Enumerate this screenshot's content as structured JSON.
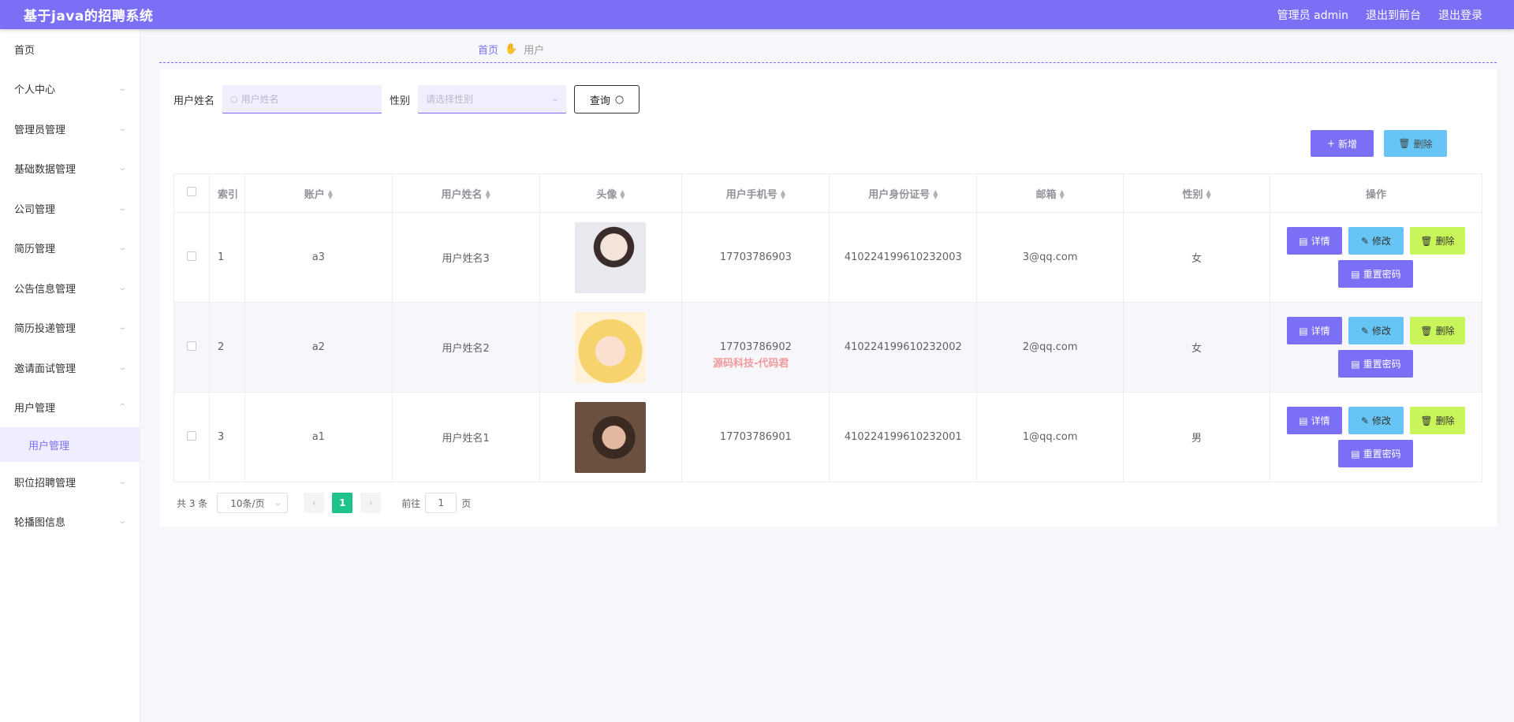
{
  "header": {
    "title": "基于java的招聘系统",
    "admin_label": "管理员 admin",
    "back_to_front": "退出到前台",
    "logout": "退出登录"
  },
  "sidebar": {
    "items": [
      {
        "label": "首页",
        "has_arrow": false
      },
      {
        "label": "个人中心",
        "has_arrow": true
      },
      {
        "label": "管理员管理",
        "has_arrow": true
      },
      {
        "label": "基础数据管理",
        "has_arrow": true
      },
      {
        "label": "公司管理",
        "has_arrow": true
      },
      {
        "label": "简历管理",
        "has_arrow": true
      },
      {
        "label": "公告信息管理",
        "has_arrow": true
      },
      {
        "label": "简历投递管理",
        "has_arrow": true
      },
      {
        "label": "邀请面试管理",
        "has_arrow": true
      },
      {
        "label": "用户管理",
        "has_arrow": true,
        "expanded": true
      },
      {
        "label": "职位招聘管理",
        "has_arrow": true
      },
      {
        "label": "轮播图信息",
        "has_arrow": true
      }
    ],
    "sub_item": "用户管理"
  },
  "breadcrumb": {
    "home": "首页",
    "current": "用户"
  },
  "search": {
    "name_label": "用户姓名",
    "name_placeholder": "用户姓名",
    "gender_label": "性别",
    "gender_placeholder": "请选择性别",
    "query_label": "查询"
  },
  "toolbar": {
    "add_label": "新增",
    "delete_label": "删除"
  },
  "table": {
    "columns": [
      "索引",
      "账户",
      "用户姓名",
      "头像",
      "用户手机号",
      "用户身份证号",
      "邮箱",
      "性别",
      "操作"
    ],
    "rows": [
      {
        "index": "1",
        "account": "a3",
        "name": "用户姓名3",
        "phone": "17703786903",
        "id_card": "410224199610232003",
        "email": "3@qq.com",
        "gender": "女"
      },
      {
        "index": "2",
        "account": "a2",
        "name": "用户姓名2",
        "phone": "17703786902",
        "id_card": "410224199610232002",
        "email": "2@qq.com",
        "gender": "女"
      },
      {
        "index": "3",
        "account": "a1",
        "name": "用户姓名1",
        "phone": "17703786901",
        "id_card": "410224199610232001",
        "email": "1@qq.com",
        "gender": "男"
      }
    ],
    "actions": {
      "detail": "详情",
      "edit": "修改",
      "delete": "删除",
      "reset": "重置密码"
    }
  },
  "watermark": "源码科技-代码君",
  "pagination": {
    "total": "共 3 条",
    "page_size": "10条/页",
    "current_page": "1",
    "goto_prefix": "前往",
    "goto_value": "1",
    "goto_suffix": "页"
  },
  "colors": {
    "accent": "#7a6ff5",
    "info": "#67c5f5",
    "warn": "#c7f55a",
    "success": "#1ec28b"
  }
}
